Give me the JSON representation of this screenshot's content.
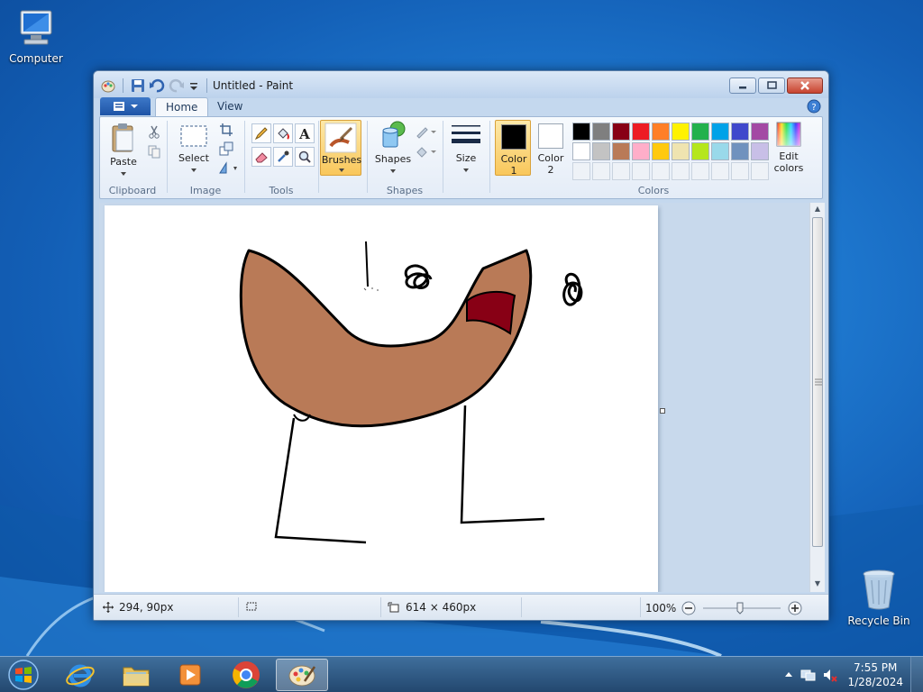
{
  "desktop": {
    "icons": [
      {
        "label": "Computer"
      },
      {
        "label": "Recycle Bin"
      }
    ]
  },
  "window": {
    "title": "Untitled - Paint",
    "tabs": [
      {
        "label": "Home",
        "active": true
      },
      {
        "label": "View",
        "active": false
      }
    ]
  },
  "ribbon": {
    "clipboard": {
      "label": "Clipboard",
      "paste": "Paste"
    },
    "image": {
      "label": "Image",
      "select": "Select"
    },
    "tools": {
      "label": "Tools"
    },
    "brushes": {
      "label": "Brushes"
    },
    "shapes": {
      "label": "Shapes",
      "shapes_btn": "Shapes"
    },
    "size": {
      "label": "Size"
    },
    "colors": {
      "label": "Colors",
      "color1": {
        "label_line1": "Color",
        "label_line2": "1",
        "value": "#000000"
      },
      "color2": {
        "label_line1": "Color",
        "label_line2": "2",
        "value": "#ffffff"
      },
      "edit_line1": "Edit",
      "edit_line2": "colors",
      "palette_row1": [
        "#000000",
        "#7f7f7f",
        "#880015",
        "#ed1c24",
        "#ff7f27",
        "#fff200",
        "#22b14c",
        "#00a2e8",
        "#3f48cc",
        "#a349a4"
      ],
      "palette_row2": [
        "#ffffff",
        "#c3c3c3",
        "#b97a57",
        "#ffaec9",
        "#ffc90e",
        "#efe4b0",
        "#b5e61d",
        "#99d9ea",
        "#7092be",
        "#c8bfe7"
      ]
    }
  },
  "status": {
    "cursor_pos": "294, 90px",
    "canvas_size": "614 × 460px",
    "zoom": "100%"
  },
  "taskbar": {
    "time": "7:55 PM",
    "date": "1/28/2024"
  },
  "drawing": {
    "face_fill": "#b97a57",
    "mouth_fill": "#880015",
    "stroke": "#000000"
  }
}
